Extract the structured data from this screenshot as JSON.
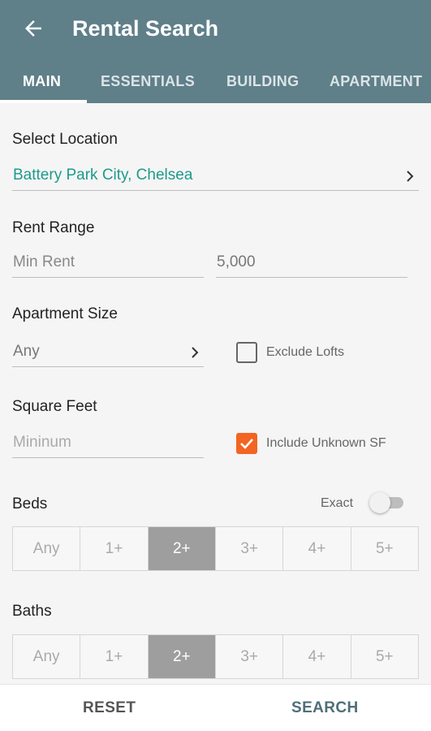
{
  "header": {
    "title": "Rental Search",
    "back_icon": "arrow-left-icon",
    "tabs": [
      {
        "label": "MAIN",
        "active": true
      },
      {
        "label": "ESSENTIALS",
        "active": false
      },
      {
        "label": "BUILDING",
        "active": false
      },
      {
        "label": "APARTMENT",
        "active": false
      }
    ]
  },
  "location": {
    "label": "Select Location",
    "value": "Battery Park City, Chelsea"
  },
  "rent": {
    "label": "Rent Range",
    "min_placeholder": "Min Rent",
    "max_value": "5,000"
  },
  "apt_size": {
    "label": "Apartment Size",
    "value": "Any",
    "exclude_lofts_label": "Exclude Lofts",
    "exclude_lofts_checked": false
  },
  "sqft": {
    "label": "Square Feet",
    "min_placeholder": "Mininum",
    "include_unknown_label": "Include Unknown SF",
    "include_unknown_checked": true
  },
  "beds": {
    "label": "Beds",
    "exact_label": "Exact",
    "exact_on": false,
    "options": [
      "Any",
      "1+",
      "2+",
      "3+",
      "4+",
      "5+"
    ],
    "selected": "2+"
  },
  "baths": {
    "label": "Baths",
    "options": [
      "Any",
      "1+",
      "2+",
      "3+",
      "4+",
      "5+"
    ],
    "selected": "2+"
  },
  "footer": {
    "reset_label": "RESET",
    "search_label": "SEARCH"
  },
  "colors": {
    "primary": "#5f7f89",
    "accent_text": "#1e9a8a",
    "checkbox_on": "#f26522",
    "selected_segment": "#9e9e9e"
  }
}
